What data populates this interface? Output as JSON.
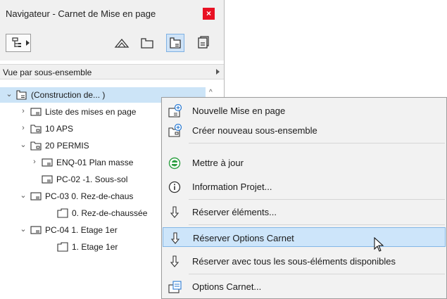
{
  "window": {
    "title": "Navigateur - Carnet de Mise en page",
    "close_glyph": "×"
  },
  "toolbar": {
    "dropdown_icon": "tree-structure-icon",
    "buttons": [
      {
        "icon": "project-map-icon",
        "active": false
      },
      {
        "icon": "view-map-icon",
        "active": false
      },
      {
        "icon": "layout-book-icon",
        "active": true
      },
      {
        "icon": "publisher-sets-icon",
        "active": false
      }
    ]
  },
  "view_selector": {
    "label": "Vue par sous-ensemble"
  },
  "tree": {
    "items": [
      {
        "label": "(Construction de... )",
        "expanded": true,
        "selected": true,
        "icon": "layout-book-icon",
        "level": 0
      },
      {
        "label": "Liste des mises en page",
        "expanded": false,
        "icon": "layout-icon",
        "level": 1
      },
      {
        "label": "10 APS",
        "expanded": false,
        "icon": "subset-icon",
        "level": 1
      },
      {
        "label": "20 PERMIS",
        "expanded": true,
        "icon": "subset-icon",
        "level": 1
      },
      {
        "label": "ENQ-01 Plan masse",
        "expanded": false,
        "icon": "layout-icon",
        "level": 2
      },
      {
        "label": "PC-02 -1. Sous-sol",
        "expanded": null,
        "icon": "layout-icon",
        "level": 2
      },
      {
        "label": "PC-03 0. Rez-de-chaus",
        "expanded": true,
        "icon": "layout-icon",
        "level": 2
      },
      {
        "label": "0. Rez-de-chaussée",
        "expanded": null,
        "icon": "drawing-icon",
        "level": 3
      },
      {
        "label": "PC-04 1. Etage 1er",
        "expanded": true,
        "icon": "layout-icon",
        "level": 2
      },
      {
        "label": "1. Etage 1er",
        "expanded": null,
        "icon": "drawing-icon",
        "level": 3
      }
    ]
  },
  "context_menu": {
    "items": [
      {
        "label": "Nouvelle Mise en page",
        "icon": "new-layout-icon"
      },
      {
        "label": "Créer nouveau sous-ensemble",
        "icon": "new-subset-icon"
      },
      {
        "label": "Mettre à jour",
        "icon": "update-icon"
      },
      {
        "label": "Information Projet...",
        "icon": "info-icon"
      },
      {
        "label": "Réserver éléments...",
        "icon": "reserve-icon"
      },
      {
        "label": "Réserver Options Carnet",
        "icon": "reserve-icon"
      },
      {
        "label": "Réserver avec tous les sous-éléments disponibles",
        "icon": "reserve-icon"
      },
      {
        "label": "Options Carnet...",
        "icon": "book-settings-icon"
      }
    ]
  },
  "colors": {
    "selection": "#cce4f7",
    "menu_hover": "#cde5fa",
    "close_red": "#e81123",
    "update_green": "#2ea043",
    "icon_blue": "#2b7bd3"
  }
}
